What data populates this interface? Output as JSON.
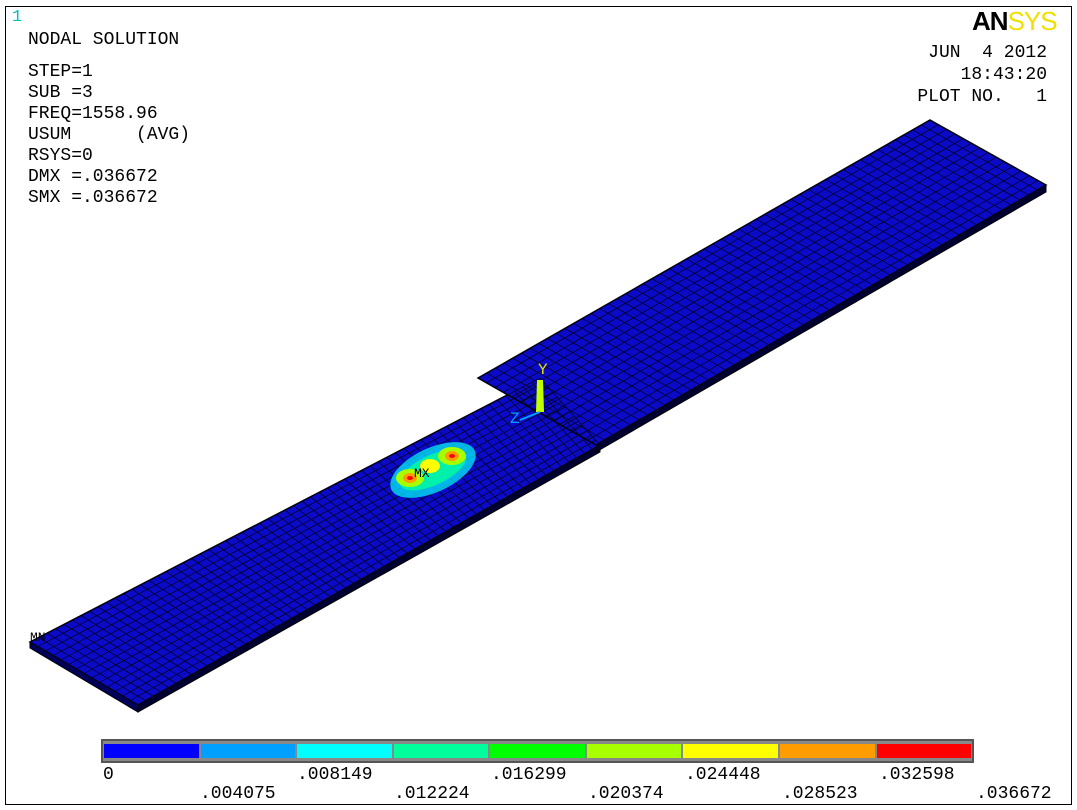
{
  "window_number": "1",
  "logo": {
    "part1": "AN",
    "part2": "SYS"
  },
  "info": {
    "title": "NODAL SOLUTION",
    "lines": [
      "STEP=1",
      "SUB =3",
      "FREQ=1558.96",
      "USUM      (AVG)",
      "RSYS=0",
      "DMX =.036672",
      "SMX =.036672"
    ]
  },
  "stamp": {
    "date": "JUN  4 2012",
    "time": "18:43:20",
    "plot": "PLOT NO.   1"
  },
  "triad": {
    "y": "Y",
    "z": "Z"
  },
  "model_labels": {
    "mx": "MX",
    "mn": "MN"
  },
  "legend": {
    "colors": [
      "#0000ff",
      "#00a0ff",
      "#00ffff",
      "#00ff9c",
      "#00ff00",
      "#a8ff00",
      "#ffff00",
      "#ff9c00",
      "#ff0000"
    ],
    "labels_top": [
      "0",
      ".008149",
      ".016299",
      ".024448",
      ".032598"
    ],
    "labels_bottom": [
      ".004075",
      ".012224",
      ".020374",
      ".028523",
      ".036672"
    ]
  },
  "colors": {
    "mesh_fill": "#0a0ac8",
    "mesh_line": "#000010",
    "background": "#ffffff"
  }
}
